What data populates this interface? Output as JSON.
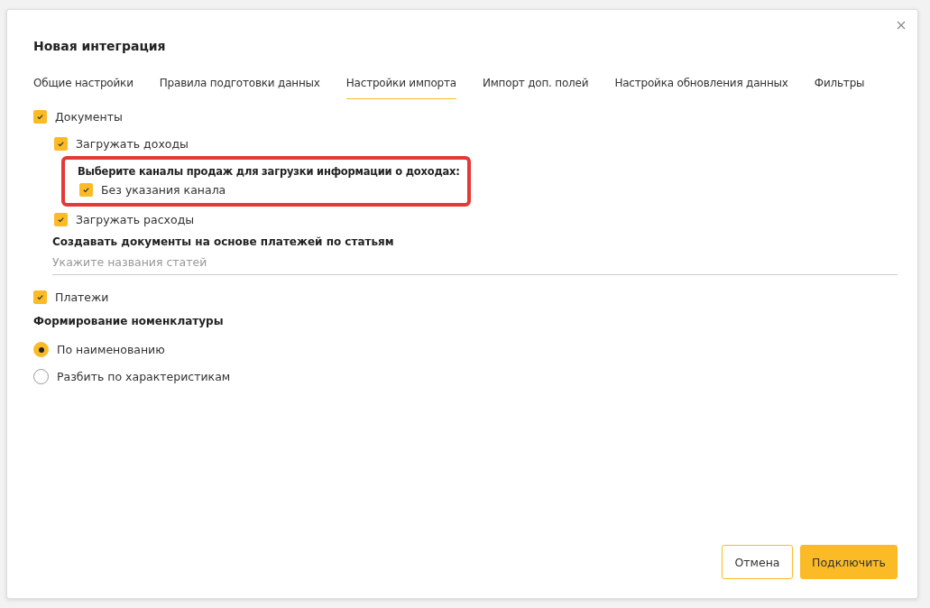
{
  "dialog": {
    "title": "Новая интеграция"
  },
  "tabs": [
    {
      "label": "Общие настройки",
      "selected": false
    },
    {
      "label": "Правила подготовки данных",
      "selected": false
    },
    {
      "label": "Настройки импорта",
      "selected": true
    },
    {
      "label": "Импорт доп. полей",
      "selected": false
    },
    {
      "label": "Настройка обновления данных",
      "selected": false
    },
    {
      "label": "Фильтры",
      "selected": false
    }
  ],
  "options": [
    {
      "kind": "checkbox",
      "label": "Документы",
      "checked": true,
      "children": [
        {
          "kind": "checkbox",
          "label": "Загружать доходы",
          "checked": true
        },
        {
          "kind": "group",
          "label": "Выберите каналы продаж для загрузки информации о доходах:",
          "highlighted": true,
          "children": [
            {
              "kind": "checkbox",
              "label": "Без указания канала",
              "checked": true
            }
          ]
        },
        {
          "kind": "checkbox",
          "label": "Загружать расходы",
          "checked": true
        },
        {
          "kind": "field",
          "label": "Создавать документы на основе платежей по статьям",
          "placeholder": "Укажите названия статей"
        }
      ]
    },
    {
      "kind": "checkbox",
      "label": "Платежи",
      "checked": true
    }
  ],
  "nomenclature": {
    "label": "Формирование номенклатуры",
    "options": [
      {
        "label": "По наименованию",
        "selected": true
      },
      {
        "label": "Разбить по характеристикам",
        "selected": false
      }
    ]
  },
  "buttons": [
    {
      "label": "Отмена",
      "kind": "secondary"
    },
    {
      "label": "Подключить",
      "kind": "primary"
    }
  ]
}
